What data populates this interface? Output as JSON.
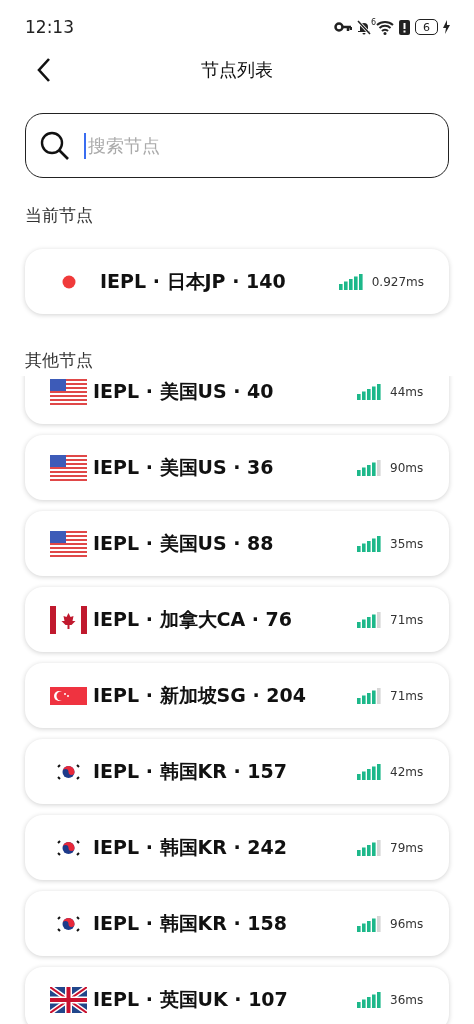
{
  "status_bar": {
    "time": "12:13",
    "wifi_label": "6",
    "battery": "6"
  },
  "header": {
    "title": "节点列表"
  },
  "search": {
    "placeholder": "搜索节点"
  },
  "current_section": {
    "title": "当前节点",
    "node": {
      "kind": "dot",
      "name": "IEPL · 日本JP · 140",
      "full_signal": true,
      "latency": "0.927ms"
    }
  },
  "other_section": {
    "title": "其他节点",
    "nodes": [
      {
        "kind": "us",
        "name": "IEPL · 美国US · 40",
        "full_signal": true,
        "latency": "44ms"
      },
      {
        "kind": "us",
        "name": "IEPL · 美国US · 36",
        "full_signal": false,
        "latency": "90ms"
      },
      {
        "kind": "us",
        "name": "IEPL · 美国US · 88",
        "full_signal": true,
        "latency": "35ms"
      },
      {
        "kind": "ca",
        "name": "IEPL · 加拿大CA · 76",
        "full_signal": false,
        "latency": "71ms"
      },
      {
        "kind": "sg",
        "name": "IEPL · 新加坡SG · 204",
        "full_signal": false,
        "latency": "71ms"
      },
      {
        "kind": "kr",
        "name": "IEPL · 韩国KR · 157",
        "full_signal": true,
        "latency": "42ms"
      },
      {
        "kind": "kr",
        "name": "IEPL · 韩国KR · 242",
        "full_signal": false,
        "latency": "79ms"
      },
      {
        "kind": "kr",
        "name": "IEPL · 韩国KR · 158",
        "full_signal": false,
        "latency": "96ms"
      },
      {
        "kind": "uk",
        "name": "IEPL · 英国UK · 107",
        "full_signal": true,
        "latency": "36ms"
      }
    ]
  }
}
